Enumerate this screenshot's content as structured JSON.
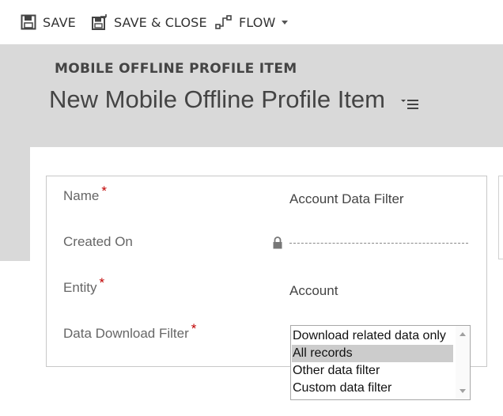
{
  "toolbar": {
    "save_label": "SAVE",
    "save_close_label": "SAVE & CLOSE",
    "flow_label": "FLOW"
  },
  "header": {
    "entity_type": "MOBILE OFFLINE PROFILE ITEM",
    "record_title": "New Mobile Offline Profile Item"
  },
  "form": {
    "name": {
      "label": "Name",
      "required_marker": "*",
      "value": "Account Data Filter"
    },
    "created_on": {
      "label": "Created On",
      "value": ""
    },
    "entity": {
      "label": "Entity",
      "required_marker": "*",
      "value": "Account"
    },
    "data_download_filter": {
      "label": "Data Download Filter",
      "required_marker": "*",
      "options": [
        "Download related data only",
        "All records",
        "Other data filter",
        "Custom data filter"
      ],
      "selected": "All records"
    }
  },
  "icons": [
    "save-icon",
    "save-close-icon",
    "flow-icon",
    "chevron-down-icon",
    "menu-icon",
    "lock-icon"
  ],
  "colors": {
    "header_band": "#d9d9d9",
    "required": "#c00000",
    "selected_option": "#cccccc"
  }
}
